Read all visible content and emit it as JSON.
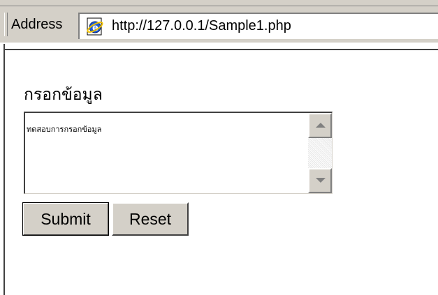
{
  "address_bar": {
    "label": "Address",
    "url": "http://127.0.0.1/Sample1.php",
    "icon": "ie-page-icon"
  },
  "form": {
    "title": "กรอกข้อมูล",
    "textarea_value": "ทดสอบการกรอกข้อมูล",
    "submit_label": "Submit",
    "reset_label": "Reset"
  },
  "colors": {
    "chrome": "#d4d0c8",
    "shadow": "#808080",
    "dark_shadow": "#404040",
    "background": "#ffffff"
  }
}
